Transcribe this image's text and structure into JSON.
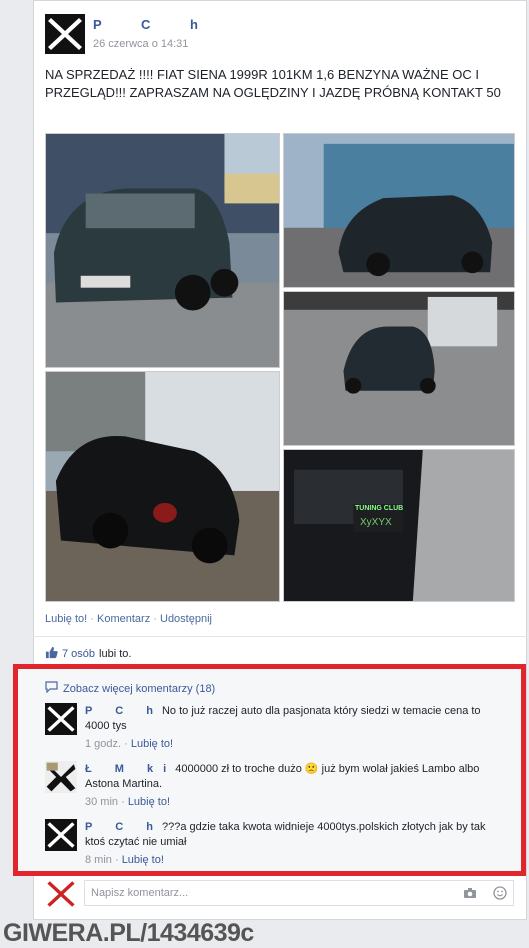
{
  "post": {
    "author": "P C h",
    "time": "26 czerwca o 14:31",
    "text": "NA SPRZEDAŻ !!!! FIAT SIENA 1999R 101KM 1,6 BENZYNA WAŻNE OC I PRZEGLĄD!!! ZAPRASZAM NA OGLĘDZINY I JAZDĘ PRÓBNĄ KONTAKT 50",
    "photo_caption_1": "TUNING CLUB",
    "photo_caption_2": "XyXYX"
  },
  "actions": {
    "like": "Lubię to!",
    "comment": "Komentarz",
    "share": "Udostępnij"
  },
  "likes": {
    "count": "7 osób",
    "suffix": "lubi to."
  },
  "comments": {
    "more": "Zobacz więcej komentarzy (18)",
    "items": [
      {
        "name": "P C h",
        "text": "No to już raczej auto dla pasjonata który siedzi w temacie cena to 4000 tys",
        "time": "1 godz.",
        "like": "Lubię to!"
      },
      {
        "name": "Ł M ki",
        "text": "4000000 zł to troche dużo 🙁 już bym wolał jakieś Lambo albo Astona Martina.",
        "time": "30 min",
        "like": "Lubię to!"
      },
      {
        "name": "P C h",
        "text": "???a gdzie taka kwota widnieje 4000tys.polskich złotych jak by tak ktoś czytać nie umiał",
        "time": "8 min",
        "like": "Lubię to!"
      }
    ],
    "write_placeholder": "Napisz komentarz..."
  },
  "watermark": "GIWERA.PL/1434639c",
  "colors": {
    "link": "#3b5998",
    "highlight": "#e0252d",
    "meta": "#90949c"
  }
}
